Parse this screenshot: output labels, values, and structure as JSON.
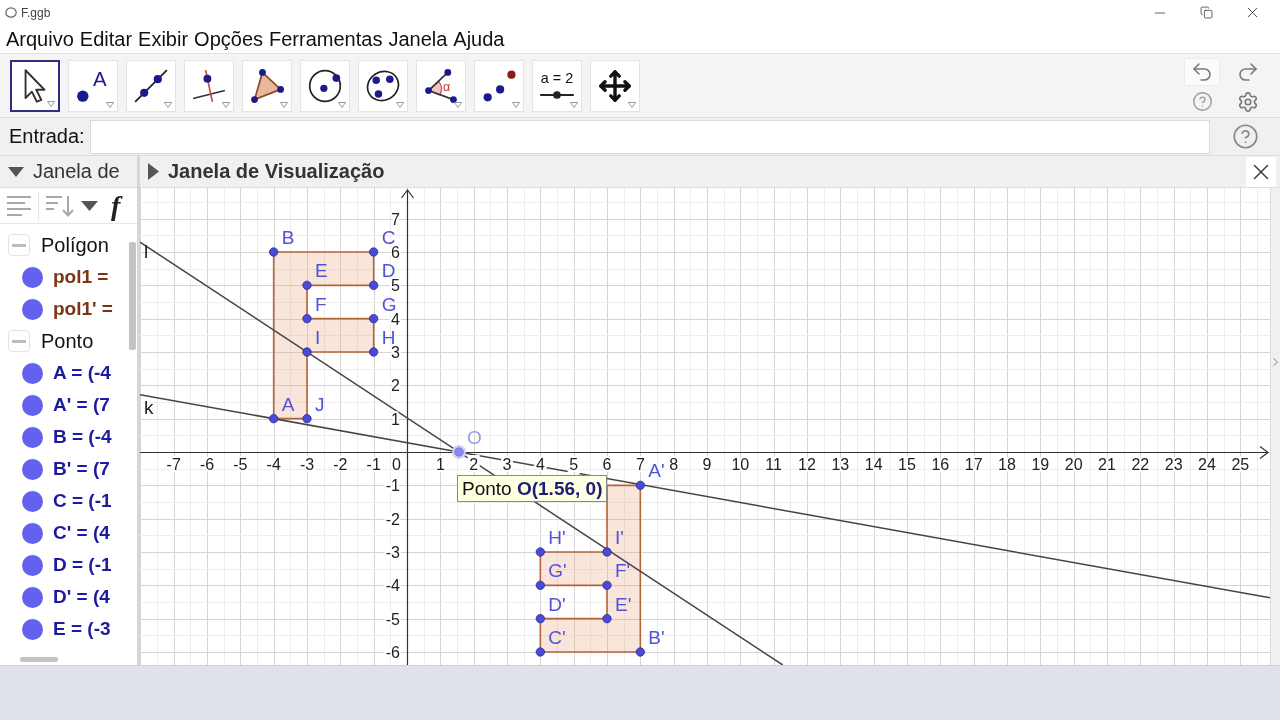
{
  "window": {
    "title": "F.ggb"
  },
  "menu": [
    "Arquivo",
    "Editar",
    "Exibir",
    "Opções",
    "Ferramentas",
    "Janela",
    "Ajuda"
  ],
  "toolbar": {
    "tools": [
      {
        "kind": "move",
        "selected": true
      },
      {
        "kind": "point",
        "selected": false,
        "glyph": "A"
      },
      {
        "kind": "line",
        "selected": false
      },
      {
        "kind": "perpendicular",
        "selected": false
      },
      {
        "kind": "polygon",
        "selected": false
      },
      {
        "kind": "circle",
        "selected": false
      },
      {
        "kind": "conic",
        "selected": false
      },
      {
        "kind": "angle",
        "selected": false,
        "glyph": "α"
      },
      {
        "kind": "reflect",
        "selected": false
      },
      {
        "kind": "slider",
        "selected": false,
        "glyph": "a = 2"
      },
      {
        "kind": "pan",
        "selected": false
      }
    ]
  },
  "input_bar": {
    "label": "Entrada:"
  },
  "algebra_view": {
    "title": "Janela de",
    "function_key": "f",
    "groups": [
      {
        "label": "Polígon",
        "kind": "polygon",
        "expanded": true,
        "children": [
          {
            "text": "pol1 ="
          },
          {
            "text": "pol1' ="
          }
        ]
      },
      {
        "label": "Ponto",
        "kind": "point",
        "expanded": true,
        "children": [
          {
            "text": "A = (-4"
          },
          {
            "text": "A' = (7"
          },
          {
            "text": "B = (-4"
          },
          {
            "text": "B' = (7"
          },
          {
            "text": "C = (-1"
          },
          {
            "text": "C' = (4"
          },
          {
            "text": "D = (-1"
          },
          {
            "text": "D' = (4"
          },
          {
            "text": "E = (-3"
          }
        ]
      }
    ]
  },
  "graphics_view": {
    "title": "Janela de Visualização",
    "x_axis_labels": [
      "-7",
      "-6",
      "-5",
      "-4",
      "-3",
      "-2",
      "-1",
      "0",
      "1",
      "2",
      "3",
      "4",
      "5",
      "6",
      "7",
      "8",
      "9",
      "10",
      "11",
      "12",
      "13",
      "14",
      "15",
      "16",
      "17",
      "18",
      "19",
      "20",
      "21",
      "22",
      "23",
      "24",
      "25"
    ],
    "y_axis_labels": [
      "7",
      "6",
      "5",
      "4",
      "3",
      "2",
      "1",
      "-1",
      "-2",
      "-3",
      "-4",
      "-5",
      "-6"
    ],
    "polygons": [
      {
        "vertices": [
          {
            "label": "B"
          },
          {
            "label": "C"
          },
          {
            "label": "E"
          },
          {
            "label": "D"
          },
          {
            "label": "F"
          },
          {
            "label": "G"
          },
          {
            "label": "I"
          },
          {
            "label": "H"
          },
          {
            "label": "A"
          },
          {
            "label": "J"
          }
        ]
      },
      {
        "vertices": [
          {
            "label": "A'"
          },
          {
            "label": "H'"
          },
          {
            "label": "I'"
          },
          {
            "label": "G'"
          },
          {
            "label": "F'"
          },
          {
            "label": "D'"
          },
          {
            "label": "E'"
          },
          {
            "label": "C'"
          },
          {
            "label": "B'"
          }
        ]
      }
    ],
    "lines": [
      {
        "label": "l"
      },
      {
        "label": "k"
      }
    ],
    "center_point": {
      "label": "O",
      "highlighted": true
    },
    "tooltip": "Ponto **O(1.56, 0)**"
  }
}
